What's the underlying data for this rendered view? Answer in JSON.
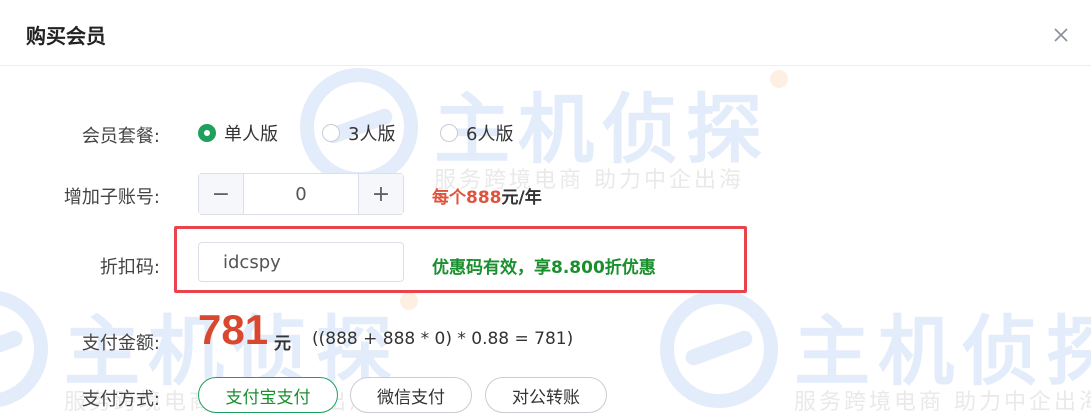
{
  "dialog": {
    "title": "购买会员",
    "close_icon": "close-icon"
  },
  "watermark": {
    "brand": "主机侦探",
    "slogan": "服务跨境电商 助力中企出海"
  },
  "form": {
    "plan": {
      "label": "会员套餐:",
      "options": [
        {
          "label": "单人版",
          "selected": true
        },
        {
          "label": "3人版",
          "selected": false
        },
        {
          "label": "6人版",
          "selected": false
        }
      ]
    },
    "sub_accounts": {
      "label": "增加子账号:",
      "value": "0",
      "minus": "−",
      "plus": "+",
      "note_prefix": "每个",
      "note_price": "888",
      "note_suffix": "元/年"
    },
    "discount": {
      "label": "折扣码:",
      "value": "idcspy",
      "message": "优惠码有效，享8.800折优惠"
    },
    "amount": {
      "label": "支付金额:",
      "value": "781",
      "unit": "元",
      "formula": "((888 + 888 * 0) * 0.88 = 781)"
    },
    "payment": {
      "label": "支付方式:",
      "options": [
        {
          "label": "支付宝支付",
          "selected": true
        },
        {
          "label": "微信支付",
          "selected": false
        },
        {
          "label": "对公转账",
          "selected": false
        }
      ]
    }
  },
  "colors": {
    "accent_green": "#1fa15d",
    "price_red": "#d9472e",
    "highlight_red": "#e9434b"
  }
}
